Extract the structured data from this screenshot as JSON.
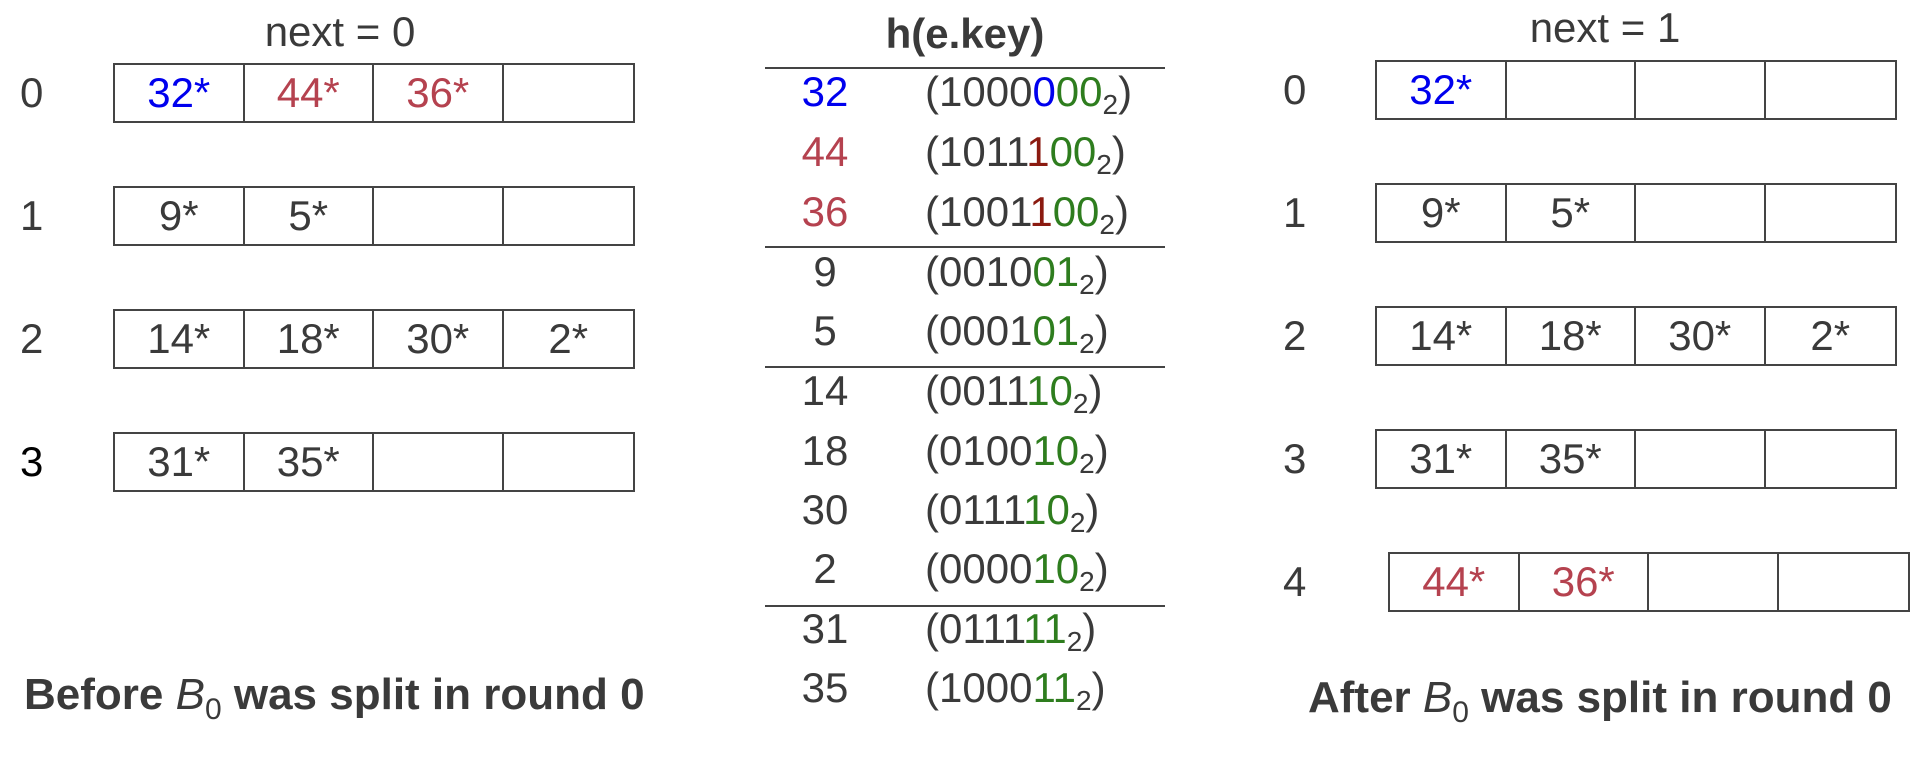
{
  "colors": {
    "text": "#3a3a3a",
    "blue": "#0000ee",
    "red": "#b5424f",
    "green": "#2e7d1e",
    "darkred": "#8b1a10"
  },
  "left": {
    "next_label": "next = 0",
    "caption_pre": "Before ",
    "caption_b": "B",
    "caption_sub": "0",
    "caption_post": " was split in round 0",
    "rows": [
      {
        "index": "0",
        "cells": [
          {
            "text": "32*",
            "color": "blue"
          },
          {
            "text": "44*",
            "color": "red"
          },
          {
            "text": "36*",
            "color": "red"
          },
          {
            "text": ""
          }
        ]
      },
      {
        "index": "1",
        "cells": [
          {
            "text": "9*"
          },
          {
            "text": "5*"
          },
          {
            "text": ""
          },
          {
            "text": ""
          }
        ]
      },
      {
        "index": "2",
        "cells": [
          {
            "text": "14*"
          },
          {
            "text": "18*"
          },
          {
            "text": "30*"
          },
          {
            "text": "2*"
          }
        ]
      },
      {
        "index": "3",
        "cells": [
          {
            "text": "31*"
          },
          {
            "text": "35*"
          },
          {
            "text": ""
          },
          {
            "text": ""
          }
        ]
      }
    ]
  },
  "middle": {
    "title": "h(e.key)",
    "rows": [
      {
        "key": "32",
        "key_color": "blue",
        "bin_plain": "1000",
        "bin_hi": "0",
        "bin_hi_color": "blue",
        "bin_tail": "00"
      },
      {
        "key": "44",
        "key_color": "red",
        "bin_plain": "1011",
        "bin_hi": "1",
        "bin_hi_color": "darkred",
        "bin_tail": "00"
      },
      {
        "key": "36",
        "key_color": "red",
        "bin_plain": "1001",
        "bin_hi": "1",
        "bin_hi_color": "darkred",
        "bin_tail": "00"
      },
      {
        "key": "9",
        "bin_plain": "0010",
        "bin_hi": "",
        "bin_tail": "01"
      },
      {
        "key": "5",
        "bin_plain": "0001",
        "bin_hi": "",
        "bin_tail": "01"
      },
      {
        "key": "14",
        "bin_plain": "0011",
        "bin_hi": "",
        "bin_tail": "10"
      },
      {
        "key": "18",
        "bin_plain": "0100",
        "bin_hi": "",
        "bin_tail": "10"
      },
      {
        "key": "30",
        "bin_plain": "0111",
        "bin_hi": "",
        "bin_tail": "10"
      },
      {
        "key": "2",
        "bin_plain": "0000",
        "bin_hi": "",
        "bin_tail": "10"
      },
      {
        "key": "31",
        "bin_plain": "0111",
        "bin_hi": "",
        "bin_tail": "11"
      },
      {
        "key": "35",
        "bin_plain": "1000",
        "bin_hi": "",
        "bin_tail": "11"
      }
    ],
    "open_paren": "(",
    "base_sub": "2",
    "close_paren": ")"
  },
  "right": {
    "next_label": "next = 1",
    "caption_pre": "After ",
    "caption_b": "B",
    "caption_sub": "0",
    "caption_post": " was split in round 0",
    "rows": [
      {
        "index": "0",
        "cells": [
          {
            "text": "32*",
            "color": "blue"
          },
          {
            "text": ""
          },
          {
            "text": ""
          },
          {
            "text": ""
          }
        ]
      },
      {
        "index": "1",
        "cells": [
          {
            "text": "9*"
          },
          {
            "text": "5*"
          },
          {
            "text": ""
          },
          {
            "text": ""
          }
        ]
      },
      {
        "index": "2",
        "cells": [
          {
            "text": "14*"
          },
          {
            "text": "18*"
          },
          {
            "text": "30*"
          },
          {
            "text": "2*"
          }
        ]
      },
      {
        "index": "3",
        "cells": [
          {
            "text": "31*"
          },
          {
            "text": "35*"
          },
          {
            "text": ""
          },
          {
            "text": ""
          }
        ]
      },
      {
        "index": "4",
        "cells": [
          {
            "text": "44*",
            "color": "red"
          },
          {
            "text": "36*",
            "color": "red"
          },
          {
            "text": ""
          },
          {
            "text": ""
          }
        ]
      }
    ]
  }
}
